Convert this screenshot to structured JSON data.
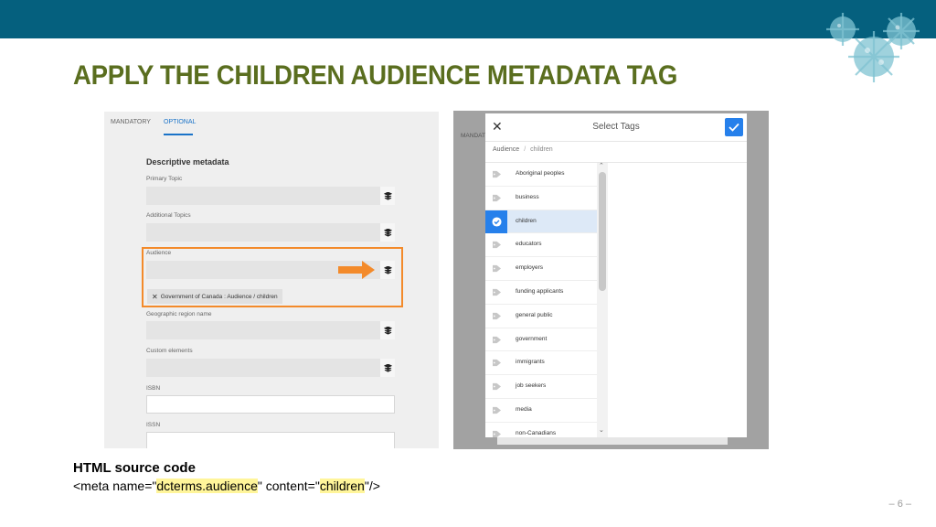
{
  "slide": {
    "title": "APPLY THE CHILDREN AUDIENCE METADATA TAG",
    "page_number": "– 6 –",
    "colors": {
      "top_bar": "#05607e",
      "title": "#5a6e1f",
      "highlight_border": "#f38a2a",
      "accent_blue": "#2680eb"
    }
  },
  "form": {
    "tabs": [
      "MANDATORY",
      "OPTIONAL"
    ],
    "active_tab": "OPTIONAL",
    "section_title": "Descriptive metadata",
    "fields": {
      "primary_topic": "Primary Topic",
      "additional_topics": "Additional Topics",
      "audience": "Audience",
      "geographic_region": "Geographic region name",
      "custom_elements": "Custom elements",
      "isbn": "ISBN",
      "issn": "ISSN"
    },
    "audience_chip": "Government of Canada : Audience / children",
    "tag_icon": "tag-picker-icon"
  },
  "dialog": {
    "background_label": "MANDATO",
    "title": "Select Tags",
    "breadcrumb": {
      "root": "Audience",
      "separator": "/",
      "current": "children"
    },
    "items": [
      {
        "label": "Aboriginal peoples",
        "selected": false
      },
      {
        "label": "business",
        "selected": false
      },
      {
        "label": "children",
        "selected": true
      },
      {
        "label": "educators",
        "selected": false
      },
      {
        "label": "employers",
        "selected": false
      },
      {
        "label": "funding applicants",
        "selected": false
      },
      {
        "label": "general public",
        "selected": false
      },
      {
        "label": "government",
        "selected": false
      },
      {
        "label": "immigrants",
        "selected": false
      },
      {
        "label": "job seekers",
        "selected": false
      },
      {
        "label": "media",
        "selected": false
      },
      {
        "label": "non-Canadians",
        "selected": false
      }
    ]
  },
  "code": {
    "title": "HTML source code",
    "prefix": "<meta name=\"",
    "name_value": "dcterms.audience",
    "middle": "\" content=\"",
    "content_value": "children",
    "suffix": "\"/>"
  }
}
